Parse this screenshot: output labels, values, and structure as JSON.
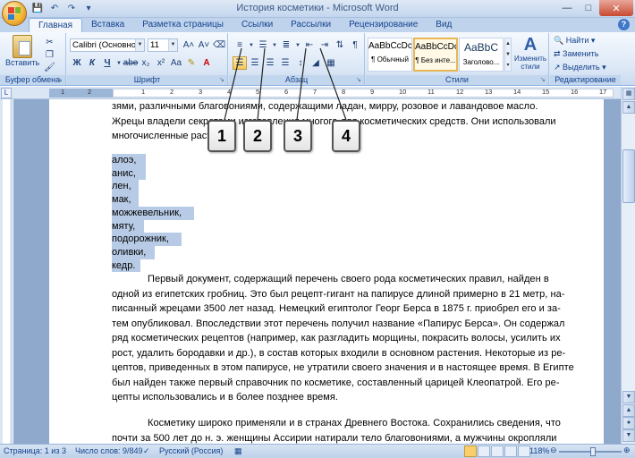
{
  "window": {
    "title": "История косметики - Microsoft Word"
  },
  "tabs": [
    "Главная",
    "Вставка",
    "Разметка страницы",
    "Ссылки",
    "Рассылки",
    "Рецензирование",
    "Вид"
  ],
  "ribbon": {
    "clipboard": {
      "label": "Буфер обмена",
      "paste": "Вставить"
    },
    "font": {
      "label": "Шрифт",
      "family": "Calibri (Основной те",
      "size": "11"
    },
    "paragraph": {
      "label": "Абзац"
    },
    "styles": {
      "label": "Стили",
      "items": [
        {
          "sample": "AaBbCcDc",
          "name": "¶ Обычный"
        },
        {
          "sample": "AaBbCcDc",
          "name": "¶ Без инте..."
        },
        {
          "sample": "AaBbC",
          "name": "Заголово..."
        }
      ],
      "change": "Изменить стили"
    },
    "editing": {
      "label": "Редактирование",
      "find": "Найти",
      "replace": "Заменить",
      "select": "Выделить"
    }
  },
  "ruler": {
    "numbers": [
      "1",
      "2",
      "1",
      "2",
      "3",
      "4",
      "5",
      "6",
      "7",
      "8",
      "9",
      "10",
      "11",
      "12",
      "13",
      "14",
      "15",
      "16",
      "17"
    ]
  },
  "document": {
    "para1": [
      "зями, различными благовониями, содержащими ладан, мирру, розовое и лавандовое масло.",
      "Жрецы владели секретами изготовления многого для косметических средств. Они использовали",
      "многочисленные растения:"
    ],
    "list": [
      "алоэ,",
      "анис,",
      "лен,",
      "мак,",
      "можжевельник,",
      "мяту,",
      "подорожник,",
      "оливки,",
      "кедр."
    ],
    "para2": [
      "Первый документ, содержащий перечень своего рода косметических правил, найден в",
      "одной из египетских гробниц. Это был рецепт-гигант на папирусе длиной примерно в 21 метр, на-",
      "писанный жрецами 3500 лет назад. Немецкий египтолог Георг Берса в 1875 г. приобрел его и за-",
      "тем опубликовал. Впоследствии этот перечень получил название «Папирус Берса». Он содержал",
      "ряд косметических рецептов (например, как разгладить морщины, покрасить волосы, усилить их",
      "рост, удалить бородавки и др.), в состав которых входили в основном растения. Некоторые из ре-",
      "цептов, приведенных в этом папирусе, не утратили своего значения и в настоящее время. В Египте",
      "был найден также первый справочник по косметике, составленный царицей Клеопатрой. Его ре-",
      "цепты использовались и в более позднее время."
    ],
    "para3": [
      "Косметику широко применяли и в странах Древнего Востока. Сохранились сведения, что",
      "почти за 500 лет до н. э. женщины Ассирии натирали тело благовониями, а мужчины окропляли"
    ]
  },
  "callouts": [
    "1",
    "2",
    "3",
    "4"
  ],
  "status": {
    "page": "Страница: 1 из 3",
    "words": "Число слов: 9/849",
    "language": "Русский (Россия)",
    "zoom": "118%"
  },
  "colors": {
    "ribbon_text": "#15428b",
    "selection": "#b8cbe6",
    "doc_background": "#8fa9cc"
  }
}
